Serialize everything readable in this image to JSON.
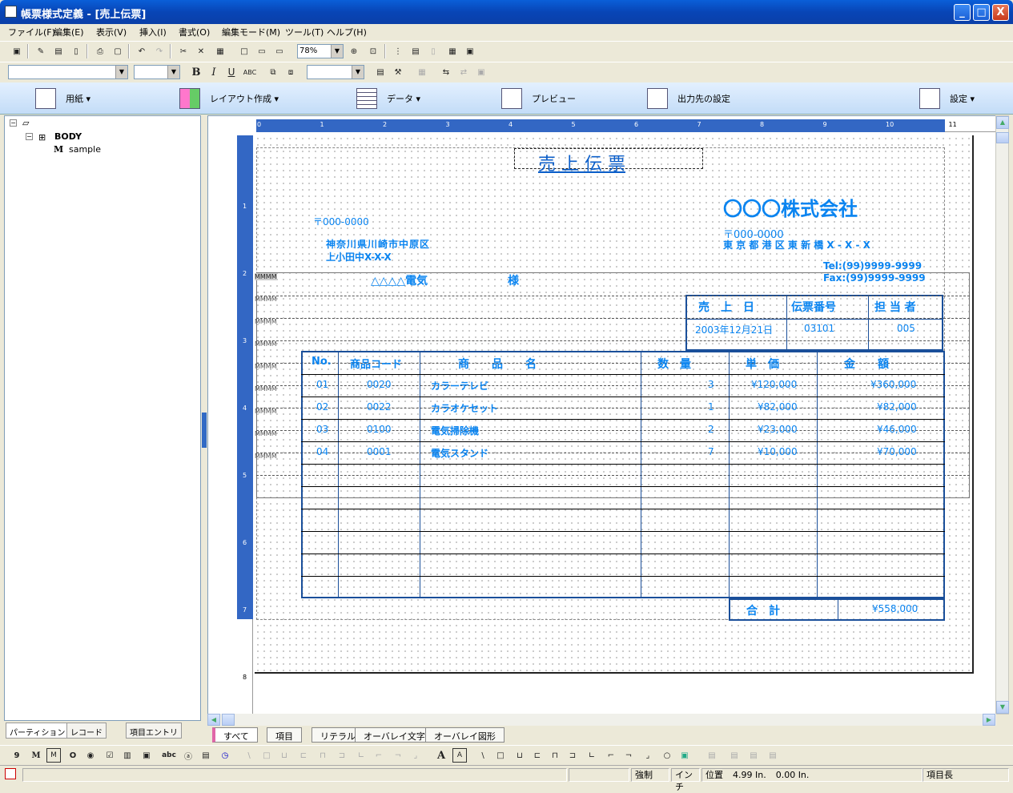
{
  "window": {
    "title": "帳票様式定義 - [売上伝票]",
    "minimize": "_",
    "maximize": "□",
    "close": "X"
  },
  "menu": [
    "ファイル(F)",
    "編集(E)",
    "表示(V)",
    "挿入(I)",
    "書式(O)",
    "編集モード(M)",
    "ツール(T)",
    "ヘルプ(H)"
  ],
  "toolbar": {
    "zoom": "78%"
  },
  "bigbar": {
    "paper": "用紙",
    "layout": "レイアウト作成",
    "data": "データ",
    "preview": "プレビュー",
    "output": "出力先の設定",
    "settings": "設定"
  },
  "tree": {
    "body": "BODY",
    "sample": "sample"
  },
  "left_tabs": [
    "パーティション",
    "レコード",
    "項目エントリ"
  ],
  "ruler": [
    "0",
    "1",
    "2",
    "3",
    "4",
    "5",
    "6",
    "7",
    "8",
    "9",
    "10",
    "11"
  ],
  "vruler": [
    "1",
    "2",
    "3",
    "4",
    "5",
    "6",
    "7",
    "8"
  ],
  "report": {
    "title": "売 上 伝 票",
    "company": "〇〇〇株式会社",
    "company_zip": "〒000-0000",
    "company_addr": "東 京 都 港 区 東 新 橋 X - X - X",
    "tel": "Tel:(99)9999-9999",
    "fax": "Fax:(99)9999-9999",
    "cust_zip": "〒000-0000",
    "cust_addr1": "神奈川県川崎市中原区",
    "cust_addr2": "上小田中X-X-X",
    "cust_name": "△△△△電気",
    "sama": "様",
    "hdr_labels": [
      "売　上　日",
      "伝票番号",
      "担 当 者"
    ],
    "hdr_values": [
      "2003年12月21日",
      "03101",
      "005"
    ],
    "col_headers": [
      "No.",
      "商品コード",
      "商　　品　　名",
      "数　量",
      "単　価",
      "金　　額"
    ],
    "rows": [
      [
        "01",
        "0020",
        "カラーテレビ",
        "3",
        "¥120,000",
        "¥360,000"
      ],
      [
        "02",
        "0022",
        "カラオケセット",
        "1",
        "¥82,000",
        "¥82,000"
      ],
      [
        "03",
        "0100",
        "電気掃除機",
        "2",
        "¥23,000",
        "¥46,000"
      ],
      [
        "04",
        "0001",
        "電気スタンド",
        "7",
        "¥10,000",
        "¥70,000"
      ]
    ],
    "total_label": "合　計",
    "total_value": "¥558,000",
    "field_marks": [
      "MMMM",
      "MMMM",
      "MMMM",
      "MMMM",
      "MMMM",
      "MMMM",
      "MMMM",
      "MMMM",
      "MMMM"
    ]
  },
  "bottom_tabs": [
    "すべて",
    "項目",
    "リテラル",
    "オーバレイ文字",
    "オーバレイ図形"
  ],
  "status": {
    "mode": "強制",
    "unit": "インチ",
    "pos_label": "位置",
    "x": "4.99 In.",
    "y": "0.00 In.",
    "item_len": "項目長"
  }
}
